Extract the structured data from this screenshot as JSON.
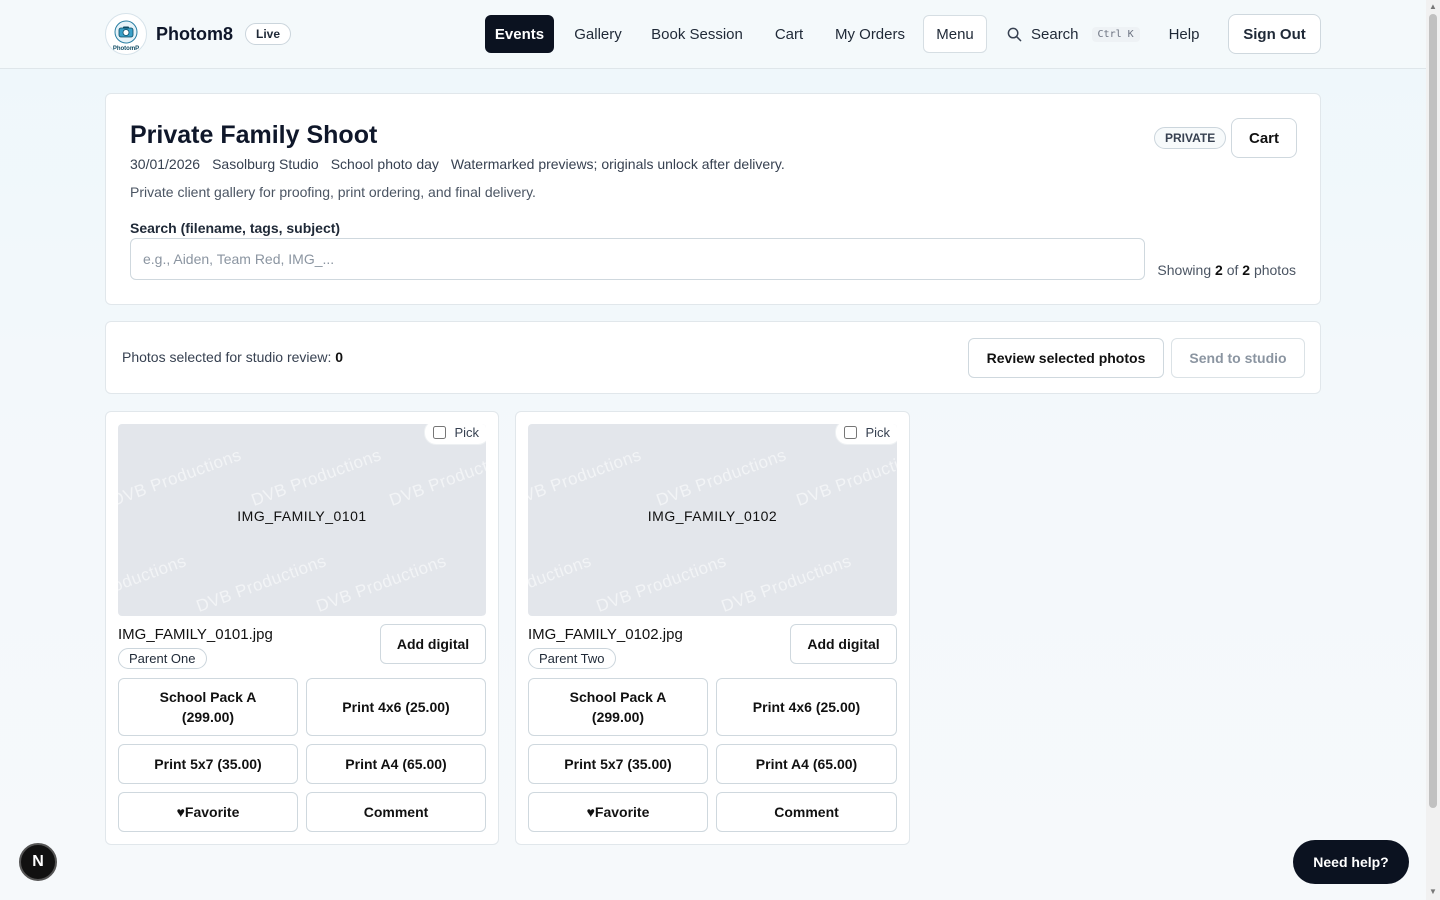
{
  "header": {
    "brand": "Photom8",
    "logo_text": "PhotomP",
    "live_badge": "Live",
    "nav": {
      "events": "Events",
      "gallery": "Gallery",
      "book_session": "Book Session",
      "cart": "Cart",
      "my_orders": "My Orders",
      "menu": "Menu",
      "search": "Search",
      "shortcut": "Ctrl K",
      "help": "Help",
      "sign_out": "Sign Out"
    }
  },
  "event": {
    "title": "Private Family Shoot",
    "date": "30/01/2026",
    "location": "Sasolburg Studio",
    "type": "School photo day",
    "note": "Watermarked previews; originals unlock after delivery.",
    "description": "Private client gallery for proofing, print ordering, and final delivery.",
    "privacy": "PRIVATE",
    "cart_label": "Cart",
    "search_label": "Search (filename, tags, subject)",
    "search_placeholder": "e.g., Aiden, Team Red, IMG_...",
    "search_value": "",
    "showing_prefix": "Showing",
    "showing_count": "2",
    "showing_of": "of",
    "showing_total": "2",
    "showing_suffix": "photos"
  },
  "selection": {
    "text": "Photos selected for studio review:",
    "count": "0",
    "review_label": "Review selected photos",
    "send_label": "Send to studio"
  },
  "photos": [
    {
      "preview_label": "IMG_FAMILY_0101",
      "filename": "IMG_FAMILY_0101.jpg",
      "tag": "Parent One",
      "pick_label": "Pick",
      "add_digital": "Add digital",
      "option_1_line1": "School Pack A",
      "option_1_line2": "(299.00)",
      "option_2": "Print 4x6 (25.00)",
      "option_3": "Print 5x7 (35.00)",
      "option_4": "Print A4 (65.00)",
      "favorite": "♥Favorite",
      "comment": "Comment"
    },
    {
      "preview_label": "IMG_FAMILY_0102",
      "filename": "IMG_FAMILY_0102.jpg",
      "tag": "Parent Two",
      "pick_label": "Pick",
      "add_digital": "Add digital",
      "option_1_line1": "School Pack A",
      "option_1_line2": "(299.00)",
      "option_2": "Print 4x6 (25.00)",
      "option_3": "Print 5x7 (35.00)",
      "option_4": "Print A4 (65.00)",
      "favorite": "♥Favorite",
      "comment": "Comment"
    }
  ],
  "watermark": "DVB Productions",
  "floating": {
    "n_badge": "N",
    "need_help": "Need help?"
  },
  "colors": {
    "primary_dark": "#0b1220",
    "background": "#eef7fb",
    "photo_placeholder": "#e3e6eb"
  }
}
